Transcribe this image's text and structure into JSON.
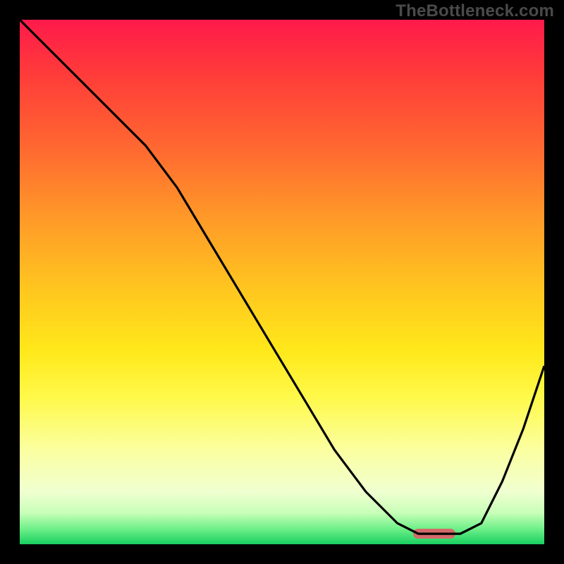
{
  "watermark": "TheBottleneck.com",
  "colors": {
    "background": "#000000",
    "curve_stroke": "#000000",
    "marker_fill": "#d36a6a"
  },
  "chart_data": {
    "type": "line",
    "title": "",
    "xlabel": "",
    "ylabel": "",
    "xlim": [
      0,
      100
    ],
    "ylim": [
      0,
      100
    ],
    "grid": false,
    "legend": false,
    "series": [
      {
        "name": "bottleneck-curve",
        "x": [
          0,
          6,
          12,
          18,
          24,
          30,
          36,
          42,
          48,
          54,
          60,
          66,
          72,
          76,
          80,
          84,
          88,
          92,
          96,
          100
        ],
        "y": [
          100,
          94,
          88,
          82,
          76,
          68,
          58,
          48,
          38,
          28,
          18,
          10,
          4,
          2,
          2,
          2,
          4,
          12,
          22,
          34
        ]
      }
    ],
    "marker": {
      "name": "optimal-range",
      "x_start": 75,
      "x_end": 83,
      "y": 2
    }
  }
}
